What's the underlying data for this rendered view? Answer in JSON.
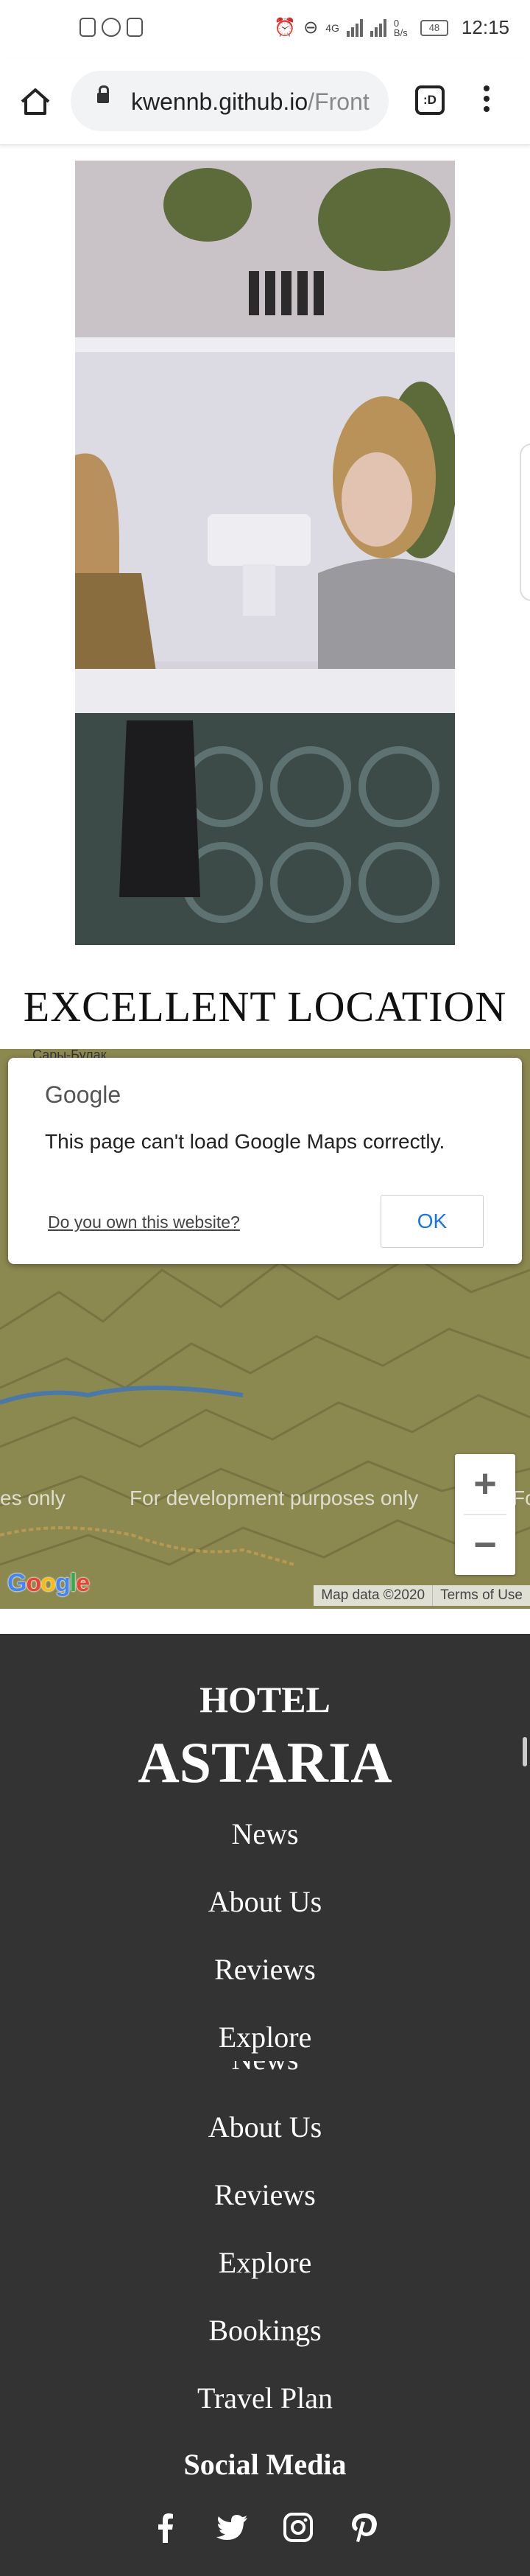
{
  "status_bar": {
    "time": "12:15",
    "network": "4G",
    "speed": "0 B/s",
    "battery": "48"
  },
  "browser": {
    "url_host": "kwennb.github.io",
    "url_path": "/Front",
    "tabs_label": ":D"
  },
  "main": {
    "section_heading": "EXCELLENT LOCATION"
  },
  "map": {
    "top_label": "Сары-Булак",
    "dialog_brand": "Google",
    "error_message": "This page can't load Google Maps correctly.",
    "owner_link": "Do you own this website?",
    "ok_label": "OK",
    "watermark_left": "es only",
    "watermark_center": "For development purposes only",
    "watermark_right": "Fo",
    "zoom_in": "+",
    "zoom_out": "−",
    "logo_text": "Google",
    "map_data": "Map data ©2020",
    "terms": "Terms of Use"
  },
  "footer": {
    "brand_line1": "HOTEL",
    "brand_line2": "ASTARIA",
    "links_overlay": [
      "News",
      "About Us",
      "Reviews",
      "Explore"
    ],
    "links_main": [
      "News",
      "About Us",
      "Reviews",
      "Explore",
      "Bookings",
      "Travel Plan"
    ],
    "social_title": "Social Media",
    "social_icons": [
      "facebook-icon",
      "twitter-icon",
      "instagram-icon",
      "pinterest-icon"
    ]
  }
}
